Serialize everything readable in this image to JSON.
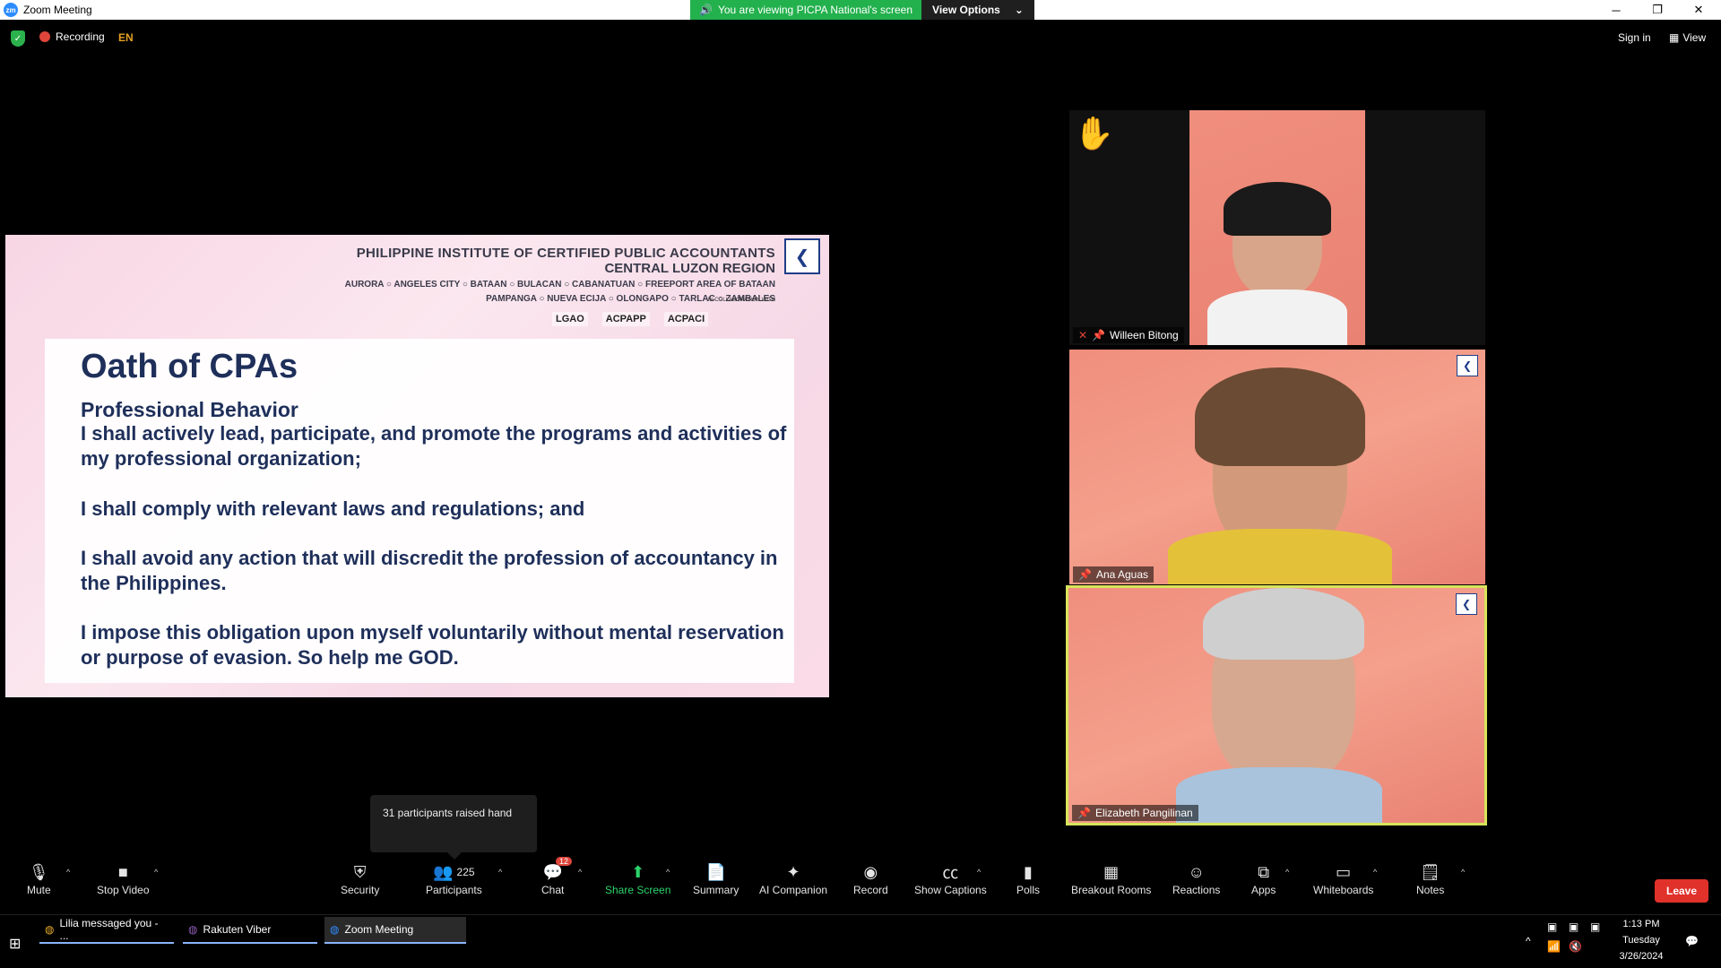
{
  "window": {
    "title": "Zoom Meeting",
    "banner_text": "You are viewing PICPA National's screen",
    "view_options": "View Options"
  },
  "topbar": {
    "recording": "Recording",
    "language": "EN",
    "sign_in": "Sign in",
    "view": "View"
  },
  "slide": {
    "org": "PHILIPPINE INSTITUTE OF CERTIFIED PUBLIC ACCOUNTANTS",
    "region": "CENTRAL LUZON REGION",
    "chapters_line1": "AURORA ○ ANGELES CITY ○ BATAAN ○ BULACAN ○ CABANATUAN ○ FREEPORT AREA OF BATAAN",
    "chapters_line2": "PAMPANGA ○ NUEVA ECIJA ○ OLONGAPO ○ TARLAC ○ ZAMBALES",
    "collab": "IN COLLABORATION WITH",
    "logos": [
      "LGAO",
      "ACPAPP",
      "ACPACI"
    ],
    "title": "Oath of CPAs",
    "subtitle": "Professional Behavior",
    "paragraphs": [
      "I shall actively lead, participate, and promote the programs and activities of my professional organization;",
      "I shall comply with relevant laws and regulations; and",
      "I shall avoid any action that will discredit the profession of accountancy in the Philippines.",
      "I impose this obligation upon myself voluntarily without mental reservation or purpose of evasion. So help me GOD."
    ]
  },
  "participants": [
    {
      "name": "Willeen Bitong",
      "hand_raised": true
    },
    {
      "name": "Ana Aguas",
      "hand_raised": false
    },
    {
      "name": "Elizabeth Pangilinan",
      "hand_raised": false,
      "speaking": true
    }
  ],
  "tooltip": "31 participants raised hand",
  "toolbar": {
    "mute": "Mute",
    "stop_video": "Stop Video",
    "security": "Security",
    "participants": "Participants",
    "participants_count": "225",
    "chat": "Chat",
    "chat_badge": "12",
    "share_screen": "Share Screen",
    "summary": "Summary",
    "ai_companion": "AI Companion",
    "record": "Record",
    "show_captions": "Show Captions",
    "polls": "Polls",
    "breakout_rooms": "Breakout Rooms",
    "reactions": "Reactions",
    "apps": "Apps",
    "whiteboards": "Whiteboards",
    "notes": "Notes",
    "leave": "Leave"
  },
  "taskbar": {
    "items": [
      "Lilia messaged you - ...",
      "Rakuten Viber",
      "Zoom Meeting"
    ],
    "time": "1:13 PM",
    "day": "Tuesday",
    "date": "3/26/2024"
  },
  "colors": {
    "banner_green": "#23b14d",
    "leave_red": "#e0312b",
    "share_green": "#2bd46a",
    "slide_navy": "#1e2f5a",
    "speaker_outline": "#d8e45a"
  }
}
